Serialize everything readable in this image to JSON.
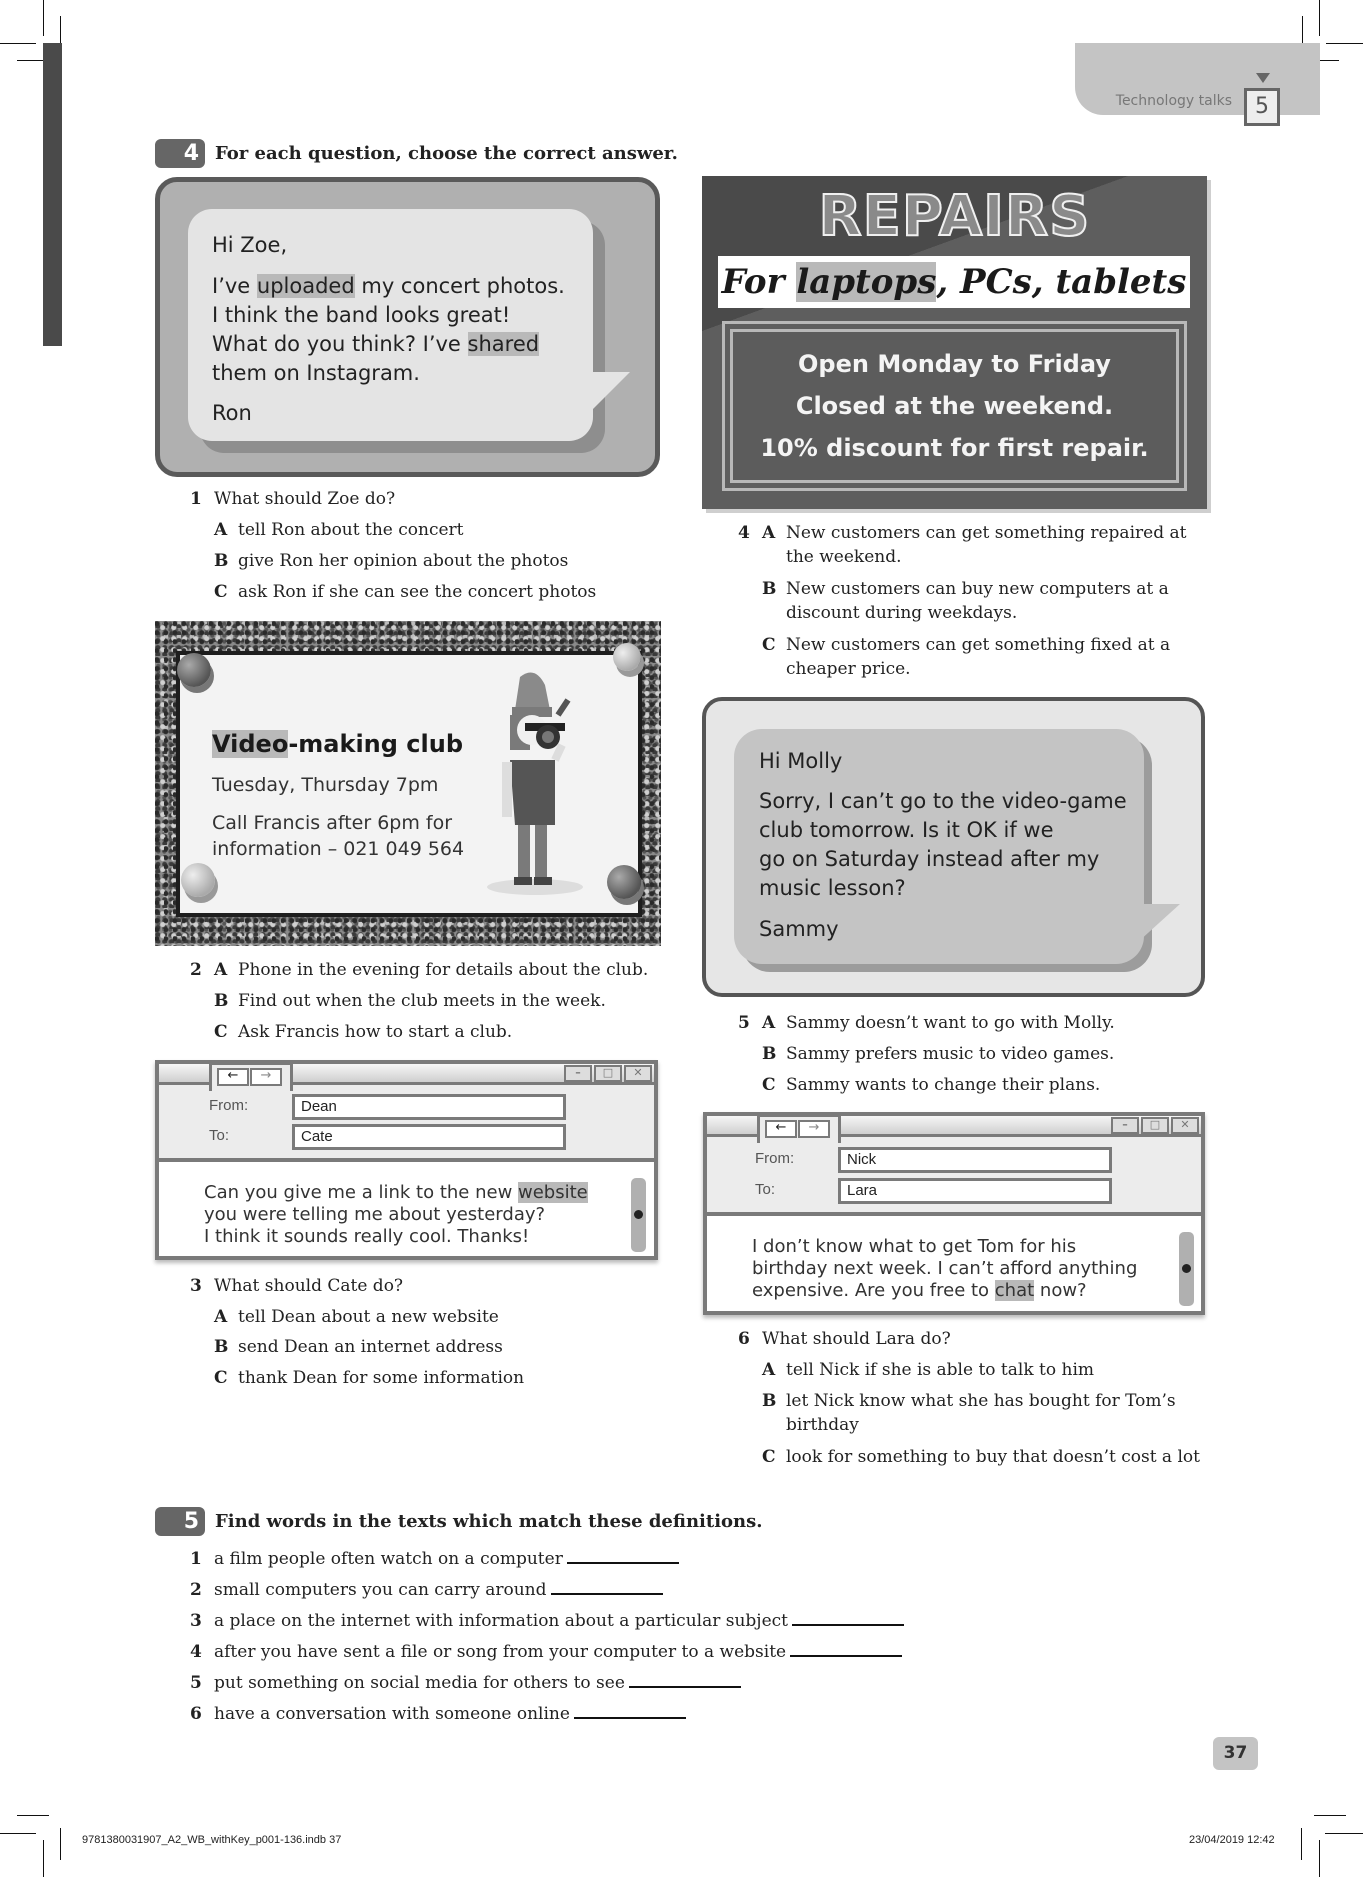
{
  "header": {
    "unit_title": "Technology talks",
    "unit_number": "5"
  },
  "exercise4": {
    "number": "4",
    "instruction": "For each question, choose the correct answer.",
    "text1": {
      "greeting": "Hi Zoe,",
      "line1_pre": "I’ve ",
      "line1_hl": "uploaded",
      "line1_post": " my concert photos.",
      "line2": "I think the band looks great!",
      "line3_pre": "What do you think? I’ve ",
      "line3_hl": "shared",
      "line4": "them on Instagram.",
      "signoff": "Ron"
    },
    "q1": {
      "num": "1",
      "question": "What should Zoe do?",
      "options": [
        {
          "letter": "A",
          "text": "tell Ron about the concert"
        },
        {
          "letter": "B",
          "text": "give Ron her opinion about the photos"
        },
        {
          "letter": "C",
          "text": "ask Ron if she can see the concert photos"
        }
      ]
    },
    "notice": {
      "title_hl": "Video",
      "title_rest": "-making club",
      "days": "Tuesday, Thursday 7pm",
      "call_line1": "Call Francis after 6pm for",
      "call_line2": "information – 021 049 564"
    },
    "q2": {
      "num": "2",
      "options": [
        {
          "letter": "A",
          "text": "Phone in the evening for details about the club."
        },
        {
          "letter": "B",
          "text": "Find out when the club meets in the week."
        },
        {
          "letter": "C",
          "text": "Ask Francis how to start a club."
        }
      ]
    },
    "email1": {
      "from_label": "From:",
      "from_value": "Dean",
      "to_label": "To:",
      "to_value": "Cate",
      "line1_pre": "Can you give me a link to the new ",
      "line1_hl": "website",
      "line2": "you were telling me about yesterday?",
      "line3": "I think it sounds really cool. Thanks!"
    },
    "q3": {
      "num": "3",
      "question": "What should Cate do?",
      "options": [
        {
          "letter": "A",
          "text": "tell Dean about a new website"
        },
        {
          "letter": "B",
          "text": "send Dean an internet address"
        },
        {
          "letter": "C",
          "text": "thank Dean for some information"
        }
      ]
    },
    "repairs": {
      "title": "REPAIRS",
      "strip_pre": "For ",
      "strip_hl": "laptops",
      "strip_post": ", PCs, tablets",
      "lines": [
        "Open Monday to Friday",
        "Closed at the weekend.",
        "10% discount for first repair."
      ]
    },
    "q4": {
      "num": "4",
      "options": [
        {
          "letter": "A",
          "line1": "New customers can get something repaired at",
          "line2": "the weekend."
        },
        {
          "letter": "B",
          "line1": "New customers can buy new computers at a",
          "line2": "discount during weekdays."
        },
        {
          "letter": "C",
          "line1": "New customers can get something fixed at a",
          "line2": "cheaper price."
        }
      ]
    },
    "text2": {
      "greeting": "Hi Molly",
      "lines": [
        "Sorry, I can’t go to the video-game",
        "club tomorrow. Is it OK if we",
        "go on Saturday instead after my",
        "music lesson?"
      ],
      "signoff": "Sammy"
    },
    "q5": {
      "num": "5",
      "options": [
        {
          "letter": "A",
          "text": "Sammy doesn’t want to go with Molly."
        },
        {
          "letter": "B",
          "text": "Sammy prefers music to video games."
        },
        {
          "letter": "C",
          "text": "Sammy wants to change their plans."
        }
      ]
    },
    "email2": {
      "from_label": "From:",
      "from_value": "Nick",
      "to_label": "To:",
      "to_value": "Lara",
      "line1": "I don’t know what to get Tom for his",
      "line2": "birthday next week. I can’t afford anything",
      "line3_pre": "expensive. Are you free to ",
      "line3_hl": "chat",
      "line3_post": " now?"
    },
    "q6": {
      "num": "6",
      "question": "What should Lara do?",
      "options": [
        {
          "letter": "A",
          "line1": "tell Nick if she is able to talk to him",
          "line2": ""
        },
        {
          "letter": "B",
          "line1": "let Nick know what she has bought for Tom’s",
          "line2": "birthday"
        },
        {
          "letter": "C",
          "line1": "look for something to buy that doesn’t cost a lot",
          "line2": ""
        }
      ]
    }
  },
  "exercise5": {
    "number": "5",
    "instruction": "Find words in the texts which match these definitions.",
    "items": [
      {
        "num": "1",
        "text": "a film people often watch on a computer"
      },
      {
        "num": "2",
        "text": "small computers you can carry around"
      },
      {
        "num": "3",
        "text": "a place on the internet with information about a particular subject"
      },
      {
        "num": "4",
        "text": "after you have sent a file or song from your computer to a website"
      },
      {
        "num": "5",
        "text": "put something on social media for others to see"
      },
      {
        "num": "6",
        "text": "have a conversation with someone online"
      }
    ]
  },
  "footer": {
    "page_number": "37",
    "slug_file": "9781380031907_A2_WB_withKey_p001-136.indb   37",
    "slug_date": "23/04/2019   12:42"
  }
}
